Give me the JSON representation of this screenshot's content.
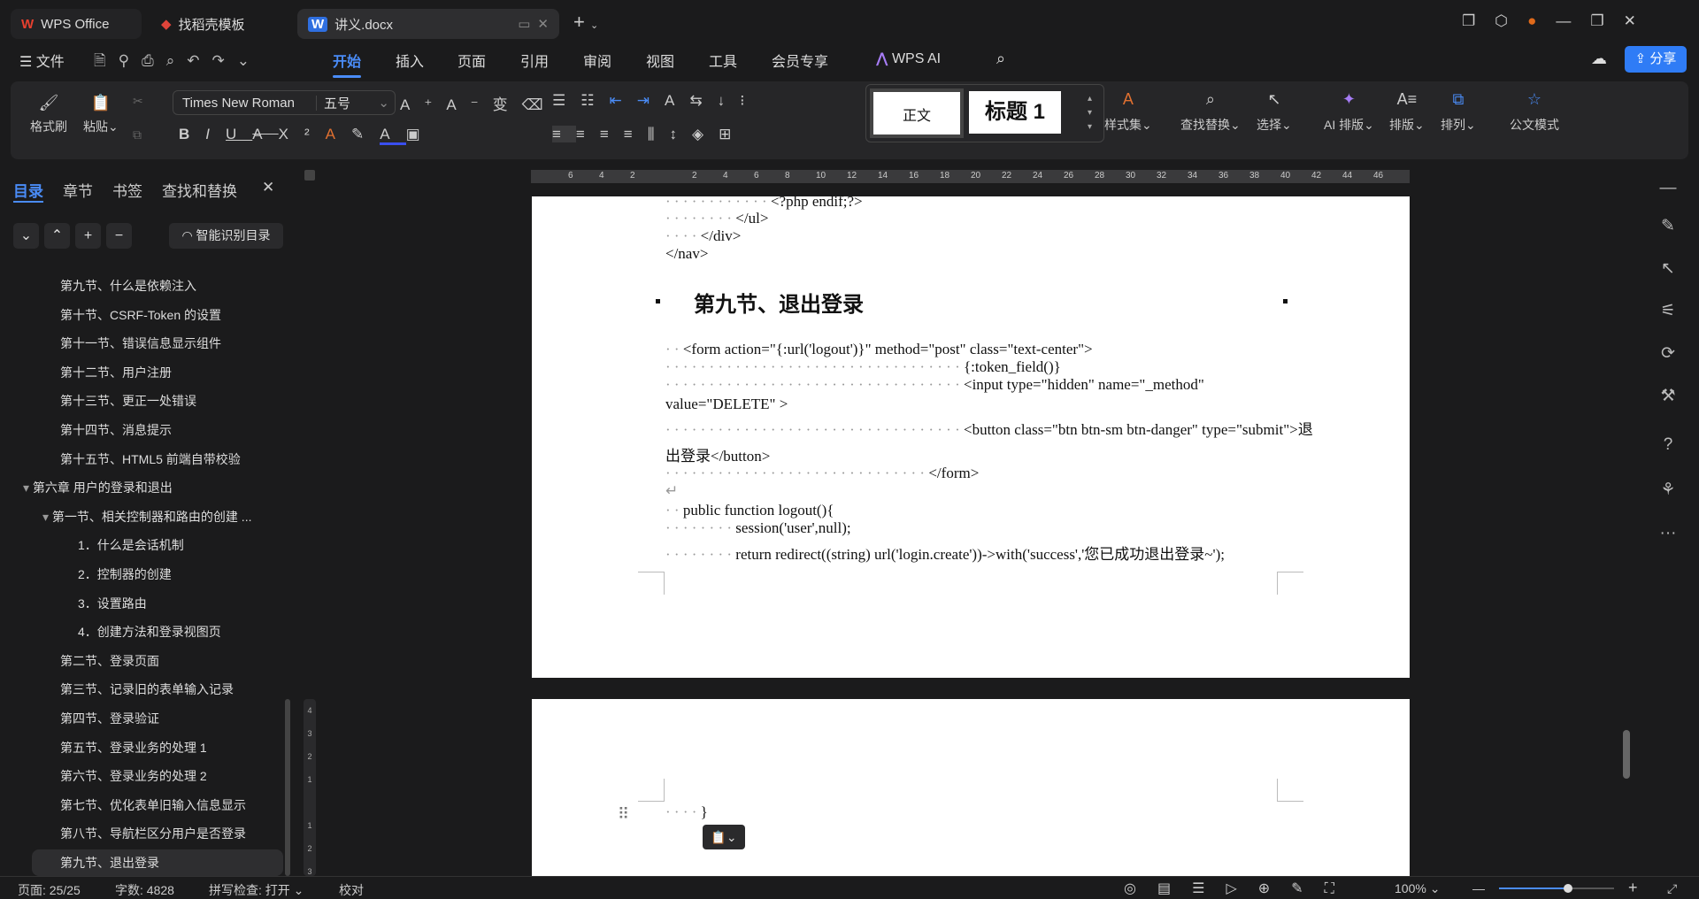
{
  "tabs": [
    {
      "label": "WPS Office"
    },
    {
      "label": "找稻壳模板"
    },
    {
      "label": "讲义.docx"
    }
  ],
  "menu": {
    "file": "文件",
    "items": [
      "开始",
      "插入",
      "页面",
      "引用",
      "审阅",
      "视图",
      "工具",
      "会员专享"
    ],
    "ai": "WPS AI",
    "share": "分享"
  },
  "ribbon": {
    "format_painter": "格式刷",
    "paste": "粘贴",
    "font": "Times New Roman",
    "size": "五号",
    "style_normal": "正文",
    "style_heading": "标题 1",
    "style_set": "样式集",
    "find_replace": "查找替换",
    "select": "选择",
    "ai_layout": "AI 排版",
    "layout": "排版",
    "arrange": "排列",
    "official": "公文模式"
  },
  "sidebar": {
    "tabs": [
      "目录",
      "章节",
      "书签",
      "查找和替换"
    ],
    "smart_toc": "智能识别目录",
    "items": [
      {
        "label": "第九节、什么是依赖注入",
        "level": 2
      },
      {
        "label": "第十节、CSRF-Token 的设置",
        "level": 2
      },
      {
        "label": "第十一节、错误信息显示组件",
        "level": 2
      },
      {
        "label": "第十二节、用户注册",
        "level": 2
      },
      {
        "label": "第十三节、更正一处错误",
        "level": 2
      },
      {
        "label": "第十四节、消息提示",
        "level": 2
      },
      {
        "label": "第十五节、HTML5 前端自带校验",
        "level": 2
      },
      {
        "label": "第六章 用户的登录和退出",
        "level": 1
      },
      {
        "label": "第一节、相关控制器和路由的创建 ...",
        "level": 2
      },
      {
        "label": "1．什么是会话机制",
        "level": 3
      },
      {
        "label": "2．控制器的创建",
        "level": 3
      },
      {
        "label": "3．设置路由",
        "level": 3
      },
      {
        "label": "4．创建方法和登录视图页",
        "level": 3
      },
      {
        "label": "第二节、登录页面",
        "level": 2
      },
      {
        "label": "第三节、记录旧的表单输入记录",
        "level": 2
      },
      {
        "label": "第四节、登录验证",
        "level": 2
      },
      {
        "label": "第五节、登录业务的处理 1",
        "level": 2
      },
      {
        "label": "第六节、登录业务的处理 2",
        "level": 2
      },
      {
        "label": "第七节、优化表单旧输入信息显示",
        "level": 2
      },
      {
        "label": "第八节、导航栏区分用户是否登录",
        "level": 2
      },
      {
        "label": "第九节、退出登录",
        "level": 2
      }
    ]
  },
  "ruler": [
    "6",
    "4",
    "2",
    "",
    "2",
    "4",
    "6",
    "8",
    "10",
    "12",
    "14",
    "16",
    "18",
    "20",
    "22",
    "24",
    "26",
    "28",
    "30",
    "32",
    "34",
    "36",
    "38",
    "40",
    "42",
    "44",
    "46"
  ],
  "doc": {
    "lines": [
      "<?php endif;?>",
      "</ul>",
      "</div>",
      "</nav>",
      "第九节、退出登录",
      "<form action=\"{:url('logout')}\" method=\"post\" class=\"text-center\">",
      "{:token_field()}",
      "<input type=\"hidden\" name=\"_method\"",
      "value=\"DELETE\" >",
      "<button class=\"btn btn-sm btn-danger\" type=\"submit\">退",
      "出登录</button>",
      "</form>",
      "public function logout(){",
      "session('user',null);",
      "return redirect((string) url('login.create'))->with('success','您已成功退出登录~');",
      "}"
    ]
  },
  "status": {
    "page": "页面: 25/25",
    "words": "字数: 4828",
    "spell": "拼写检查: 打开",
    "proof": "校对",
    "zoom": "100%",
    "zoom_fraction": 0.6
  }
}
